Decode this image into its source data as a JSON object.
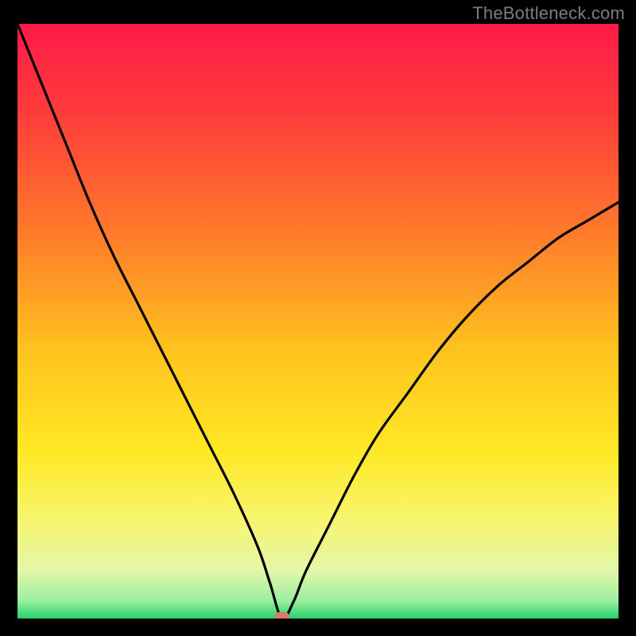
{
  "watermark": "TheBottleneck.com",
  "chart_data": {
    "type": "line",
    "title": "",
    "xlabel": "",
    "ylabel": "",
    "xlim": [
      0,
      100
    ],
    "ylim": [
      0,
      100
    ],
    "grid": false,
    "legend": false,
    "notes": "Bottleneck deviation curve. Background is a vertical red→yellow→green gradient (100→0). The black curve is the absolute deviation from an optimal point and dips to ~0 near x≈44. A small rounded marker highlights the minimum at (44, 0).",
    "gradient_stops": [
      {
        "y_pct": 0,
        "color": "#ff1a47"
      },
      {
        "y_pct": 15,
        "color": "#ff3c3c"
      },
      {
        "y_pct": 35,
        "color": "#ff7a2a"
      },
      {
        "y_pct": 55,
        "color": "#ffc31e"
      },
      {
        "y_pct": 72,
        "color": "#ffe825"
      },
      {
        "y_pct": 84,
        "color": "#f6f673"
      },
      {
        "y_pct": 92,
        "color": "#e2f7a8"
      },
      {
        "y_pct": 97,
        "color": "#9ceea2"
      },
      {
        "y_pct": 100,
        "color": "#25d36a"
      }
    ],
    "series": [
      {
        "name": "bottleneck-curve",
        "x": [
          0,
          4,
          8,
          12,
          16,
          20,
          24,
          28,
          32,
          36,
          40,
          42,
          44,
          46,
          48,
          52,
          56,
          60,
          65,
          70,
          75,
          80,
          85,
          90,
          95,
          100
        ],
        "y": [
          100,
          90,
          80,
          70,
          61,
          53,
          45,
          37,
          29,
          21,
          12,
          6,
          0,
          3,
          8,
          16,
          24,
          31,
          38,
          45,
          51,
          56,
          60,
          64,
          67,
          70
        ]
      }
    ],
    "min_marker": {
      "x": 44,
      "y": 0
    }
  }
}
